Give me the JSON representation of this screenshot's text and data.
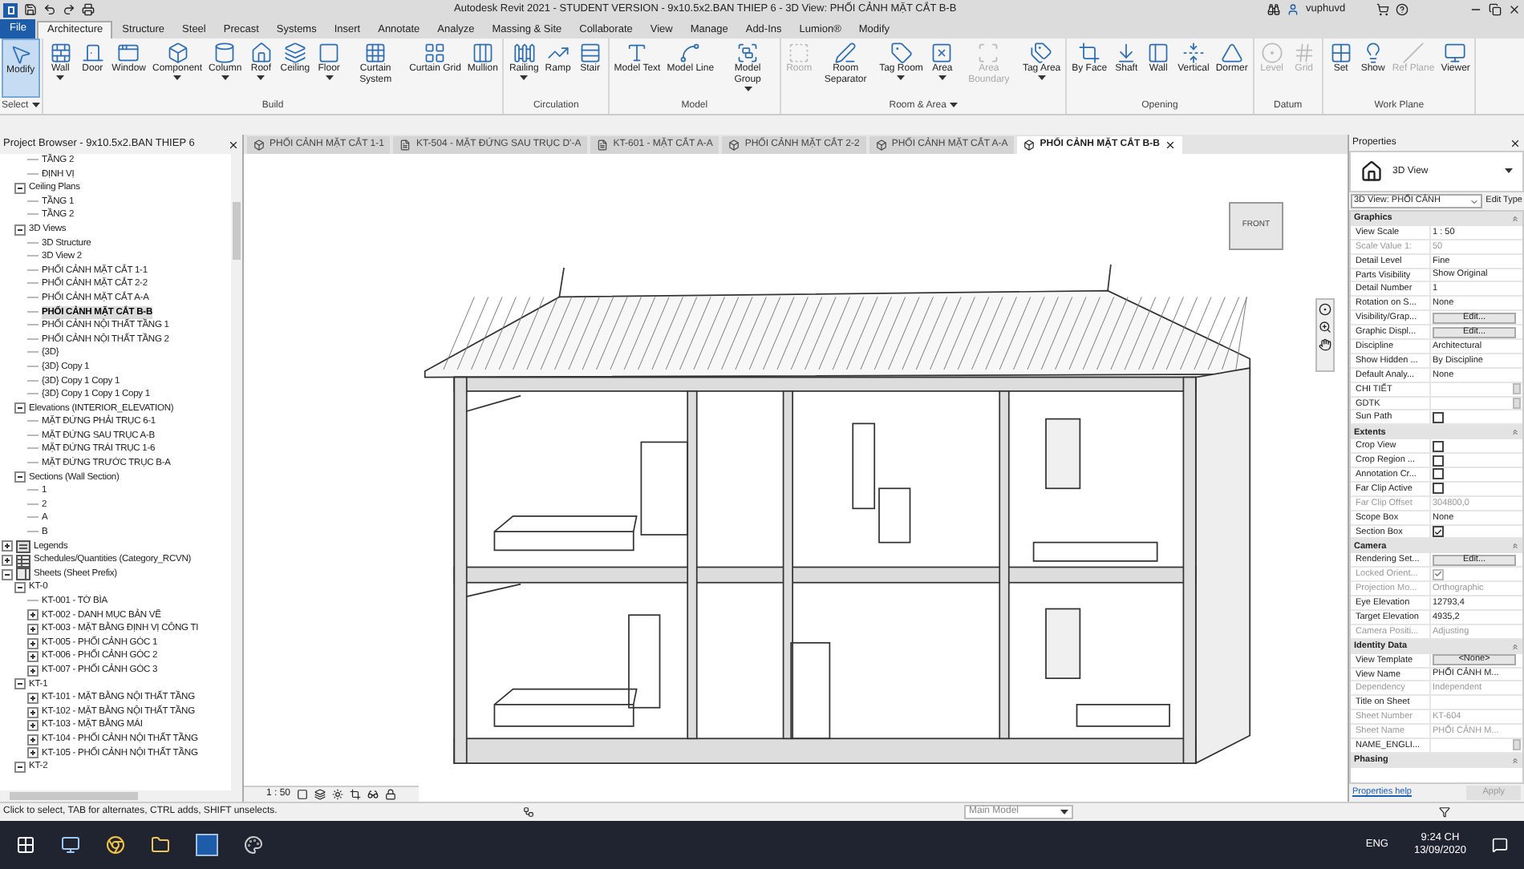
{
  "title_bar": {
    "title": "Autodesk Revit 2021 - STUDENT VERSION - 9x10.5x2.BAN THIEP 6 - 3D View: PHỐI CẢNH MẶT CẮT B-B",
    "user": "vuphuvd"
  },
  "ribbon_tabs": [
    {
      "label": "File",
      "selected": false,
      "kind": "file"
    },
    {
      "label": "Architecture",
      "selected": true,
      "kind": "tab"
    },
    {
      "label": "Structure",
      "selected": false,
      "kind": "tab"
    },
    {
      "label": "Steel",
      "selected": false,
      "kind": "tab"
    },
    {
      "label": "Precast",
      "selected": false,
      "kind": "tab"
    },
    {
      "label": "Systems",
      "selected": false,
      "kind": "tab"
    },
    {
      "label": "Insert",
      "selected": false,
      "kind": "tab"
    },
    {
      "label": "Annotate",
      "selected": false,
      "kind": "tab"
    },
    {
      "label": "Analyze",
      "selected": false,
      "kind": "tab"
    },
    {
      "label": "Massing & Site",
      "selected": false,
      "kind": "tab"
    },
    {
      "label": "Collaborate",
      "selected": false,
      "kind": "tab"
    },
    {
      "label": "View",
      "selected": false,
      "kind": "tab"
    },
    {
      "label": "Manage",
      "selected": false,
      "kind": "tab"
    },
    {
      "label": "Add-Ins",
      "selected": false,
      "kind": "tab"
    },
    {
      "label": "Lumion®",
      "selected": false,
      "kind": "tab"
    },
    {
      "label": "Modify",
      "selected": false,
      "kind": "tab"
    }
  ],
  "ribbon_groups": [
    {
      "label": "Select",
      "dropdown": true,
      "buttons": [
        {
          "label": "Modify",
          "selected": true,
          "dropdown": false,
          "disabled": false
        }
      ]
    },
    {
      "label": "Build",
      "dropdown": false,
      "buttons": [
        {
          "label": "Wall",
          "selected": false,
          "dropdown": true,
          "disabled": false
        },
        {
          "label": "Door",
          "selected": false,
          "dropdown": false,
          "disabled": false
        },
        {
          "label": "Window",
          "selected": false,
          "dropdown": false,
          "disabled": false
        },
        {
          "label": "Component",
          "selected": false,
          "dropdown": true,
          "disabled": false
        },
        {
          "label": "Column",
          "selected": false,
          "dropdown": true,
          "disabled": false
        },
        {
          "label": "Roof",
          "selected": false,
          "dropdown": true,
          "disabled": false
        },
        {
          "label": "Ceiling",
          "selected": false,
          "dropdown": false,
          "disabled": false
        },
        {
          "label": "Floor",
          "selected": false,
          "dropdown": true,
          "disabled": false
        },
        {
          "label": "Curtain System",
          "selected": false,
          "dropdown": false,
          "disabled": false
        },
        {
          "label": "Curtain Grid",
          "selected": false,
          "dropdown": false,
          "disabled": false
        },
        {
          "label": "Mullion",
          "selected": false,
          "dropdown": false,
          "disabled": false
        }
      ]
    },
    {
      "label": "Circulation",
      "dropdown": false,
      "buttons": [
        {
          "label": "Railing",
          "selected": false,
          "dropdown": true,
          "disabled": false
        },
        {
          "label": "Ramp",
          "selected": false,
          "dropdown": false,
          "disabled": false
        },
        {
          "label": "Stair",
          "selected": false,
          "dropdown": false,
          "disabled": false
        }
      ]
    },
    {
      "label": "Model",
      "dropdown": false,
      "buttons": [
        {
          "label": "Model Text",
          "selected": false,
          "dropdown": false,
          "disabled": false
        },
        {
          "label": "Model Line",
          "selected": false,
          "dropdown": false,
          "disabled": false
        },
        {
          "label": "Model Group",
          "selected": false,
          "dropdown": true,
          "disabled": false
        }
      ]
    },
    {
      "label": "Room & Area",
      "dropdown": true,
      "buttons": [
        {
          "label": "Room",
          "selected": false,
          "dropdown": false,
          "disabled": true
        },
        {
          "label": "Room Separator",
          "selected": false,
          "dropdown": false,
          "disabled": false
        },
        {
          "label": "Tag Room",
          "selected": false,
          "dropdown": true,
          "disabled": false
        },
        {
          "label": "Area",
          "selected": false,
          "dropdown": true,
          "disabled": false
        },
        {
          "label": "Area Boundary",
          "selected": false,
          "dropdown": false,
          "disabled": true
        },
        {
          "label": "Tag Area",
          "selected": false,
          "dropdown": true,
          "disabled": false
        }
      ]
    },
    {
      "label": "Opening",
      "dropdown": false,
      "buttons": [
        {
          "label": "By Face",
          "selected": false,
          "dropdown": false,
          "disabled": false
        },
        {
          "label": "Shaft",
          "selected": false,
          "dropdown": false,
          "disabled": false
        },
        {
          "label": "Wall",
          "selected": false,
          "dropdown": false,
          "disabled": false
        },
        {
          "label": "Vertical",
          "selected": false,
          "dropdown": false,
          "disabled": false
        },
        {
          "label": "Dormer",
          "selected": false,
          "dropdown": false,
          "disabled": false
        }
      ]
    },
    {
      "label": "Datum",
      "dropdown": false,
      "buttons": [
        {
          "label": "Level",
          "selected": false,
          "dropdown": false,
          "disabled": true
        },
        {
          "label": "Grid",
          "selected": false,
          "dropdown": false,
          "disabled": true
        }
      ]
    },
    {
      "label": "Work Plane",
      "dropdown": false,
      "buttons": [
        {
          "label": "Set",
          "selected": false,
          "dropdown": false,
          "disabled": false
        },
        {
          "label": "Show",
          "selected": false,
          "dropdown": false,
          "disabled": false
        },
        {
          "label": "Ref Plane",
          "selected": false,
          "dropdown": false,
          "disabled": true
        },
        {
          "label": "Viewer",
          "selected": false,
          "dropdown": false,
          "disabled": false
        }
      ]
    }
  ],
  "project_browser": {
    "title": "Project Browser - 9x10.5x2.BAN THIEP 6",
    "tree": [
      {
        "children": [
          {
            "children": [
              {
                "label": "TẦNG 2",
                "selected": false
              },
              {
                "label": "ĐỊNH VỊ",
                "selected": false
              }
            ]
          },
          {
            "label": "Ceiling Plans",
            "expanded": true,
            "selected": false,
            "children": [
              {
                "label": "TẦNG 1",
                "selected": false
              },
              {
                "label": "TẦNG 2",
                "selected": false
              }
            ]
          },
          {
            "label": "3D Views",
            "expanded": true,
            "selected": false,
            "children": [
              {
                "label": "3D Structure",
                "selected": false
              },
              {
                "label": "3D View 2",
                "selected": false
              },
              {
                "label": "PHỐI CẢNH MẶT CẮT 1-1",
                "selected": false
              },
              {
                "label": "PHỐI CẢNH MẶT CẮT 2-2",
                "selected": false
              },
              {
                "label": "PHỐI CẢNH MẶT CẮT A-A",
                "selected": false
              },
              {
                "label": "PHỐI CẢNH MẶT CẮT B-B",
                "selected": true
              },
              {
                "label": "PHỐI CẢNH NỘI THẤT TẦNG 1",
                "selected": false
              },
              {
                "label": "PHỐI CẢNH NỘI THẤT TẦNG  2",
                "selected": false
              },
              {
                "label": "{3D}",
                "selected": false
              },
              {
                "label": "{3D} Copy 1",
                "selected": false
              },
              {
                "label": "{3D} Copy 1 Copy 1",
                "selected": false
              },
              {
                "label": "{3D} Copy 1 Copy 1 Copy 1",
                "selected": false
              }
            ]
          },
          {
            "label": "Elevations (INTERIOR_ELEVATION)",
            "expanded": true,
            "selected": false,
            "children": [
              {
                "label": "MẶT ĐỨNG PHẢI TRỤC 6-1",
                "selected": false
              },
              {
                "label": "MẶT ĐỨNG SAU TRỤC A-B",
                "selected": false
              },
              {
                "label": "MẶT ĐỨNG TRÁI TRỤC 1-6",
                "selected": false
              },
              {
                "label": "MẶT ĐỨNG TRƯỚC TRỤC B-A",
                "selected": false
              }
            ]
          },
          {
            "label": "Sections (Wall Section)",
            "expanded": true,
            "selected": false,
            "children": [
              {
                "label": "1",
                "selected": false
              },
              {
                "label": "2",
                "selected": false
              },
              {
                "label": "A",
                "selected": false
              },
              {
                "label": "B",
                "selected": false
              }
            ]
          }
        ]
      },
      {
        "label": "Legends",
        "expanded": false,
        "selected": false,
        "kind": "legend"
      },
      {
        "label": "Schedules/Quantities (Category_RCVN)",
        "expanded": false,
        "selected": false,
        "kind": "schedule"
      },
      {
        "label": "Sheets (Sheet Prefix)",
        "expanded": true,
        "selected": false,
        "kind": "sheet",
        "children": [
          {
            "label": "KT-0",
            "expanded": true,
            "selected": false,
            "children": [
              {
                "label": "KT-001 - TỜ BÌA",
                "selected": false
              },
              {
                "label": "KT-002 - DANH MỤC BẢN VẼ",
                "expanded": false,
                "selected": false
              },
              {
                "label": "KT-003 - MẶT BẰNG ĐỊNH VỊ CÔNG TI",
                "expanded": false,
                "selected": false
              },
              {
                "label": "KT-005 - PHỐI CẢNH GÓC 1",
                "expanded": false,
                "selected": false
              },
              {
                "label": "KT-006 - PHỐI CẢNH GÓC 2",
                "expanded": false,
                "selected": false
              },
              {
                "label": "KT-007 - PHỐI CẢNH GÓC 3",
                "expanded": false,
                "selected": false
              }
            ]
          },
          {
            "label": "KT-1",
            "expanded": true,
            "selected": false,
            "children": [
              {
                "label": "KT-101 - MẶT BẰNG NỘI THẤT TẦNG",
                "expanded": false,
                "selected": false
              },
              {
                "label": "KT-102 - MẶT BẰNG NỘI THẤT TẦNG",
                "expanded": false,
                "selected": false
              },
              {
                "label": "KT-103 - MẶT BẰNG MÁI",
                "expanded": false,
                "selected": false
              },
              {
                "label": "KT-104 - PHỐI CẢNH NỘI THẤT TẦNG",
                "expanded": false,
                "selected": false
              },
              {
                "label": "KT-105 - PHỐI CẢNH NỘI THẤT TẦNG",
                "expanded": false,
                "selected": false
              }
            ]
          },
          {
            "label": "KT-2",
            "expanded": true,
            "selected": false
          }
        ]
      }
    ]
  },
  "view_tabs": [
    {
      "label": "PHỐI CẢNH MẶT CẮT 1-1",
      "selected": false,
      "kind": "model"
    },
    {
      "label": "KT-504 - MẶT ĐỨNG SAU TRỤC D'-A",
      "selected": false,
      "kind": "sheet"
    },
    {
      "label": "KT-601 - MẶT CẮT A-A",
      "selected": false,
      "kind": "sheet"
    },
    {
      "label": "PHỐI CẢNH MẶT CẮT 2-2",
      "selected": false,
      "kind": "model"
    },
    {
      "label": "PHỐI CẢNH MẶT CẮT A-A",
      "selected": false,
      "kind": "model"
    },
    {
      "label": "PHỐI CẢNH MẶT CẮT B-B",
      "selected": true,
      "kind": "model"
    }
  ],
  "view_cube": {
    "face": "FRONT"
  },
  "view_control_bar": {
    "scale": "1 : 50"
  },
  "properties": {
    "title": "Properties",
    "type": "3D View",
    "instance": "3D View: PHỐI CẢNH",
    "edit_type": "Edit Type",
    "rows": [
      {
        "kind": "header",
        "label": "Graphics"
      },
      {
        "kind": "text",
        "label": "View Scale",
        "value": "1 : 50",
        "disabled": false
      },
      {
        "kind": "text",
        "label": "Scale Value    1:",
        "value": "50",
        "disabled": true
      },
      {
        "kind": "text",
        "label": "Detail Level",
        "value": "Fine",
        "disabled": false
      },
      {
        "kind": "text",
        "label": "Parts Visibility",
        "value": "Show Original",
        "disabled": false
      },
      {
        "kind": "text",
        "label": "Detail Number",
        "value": "1",
        "disabled": false
      },
      {
        "kind": "text",
        "label": "Rotation on S...",
        "value": "None",
        "disabled": false
      },
      {
        "kind": "button",
        "label": "Visibility/Grap...",
        "value": "Edit...",
        "disabled": false
      },
      {
        "kind": "button",
        "label": "Graphic Displ...",
        "value": "Edit...",
        "disabled": false
      },
      {
        "kind": "text",
        "label": "Discipline",
        "value": "Architectural",
        "disabled": false
      },
      {
        "kind": "text",
        "label": "Show Hidden ...",
        "value": "By Discipline",
        "disabled": false
      },
      {
        "kind": "text",
        "label": "Default Analy...",
        "value": "None",
        "disabled": false
      },
      {
        "kind": "slot",
        "label": "CHI TIẾT",
        "disabled": false
      },
      {
        "kind": "slot",
        "label": "GDTK",
        "disabled": false
      },
      {
        "kind": "checkbox",
        "label": "Sun Path",
        "checked": false,
        "disabled": false
      },
      {
        "kind": "header",
        "label": "Extents"
      },
      {
        "kind": "checkbox",
        "label": "Crop View",
        "checked": false,
        "disabled": false
      },
      {
        "kind": "checkbox",
        "label": "Crop Region ...",
        "checked": false,
        "disabled": false
      },
      {
        "kind": "checkbox",
        "label": "Annotation Cr...",
        "checked": false,
        "disabled": false
      },
      {
        "kind": "checkbox",
        "label": "Far Clip Active",
        "checked": false,
        "disabled": false
      },
      {
        "kind": "text",
        "label": "Far Clip Offset",
        "value": "304800,0",
        "disabled": true
      },
      {
        "kind": "text",
        "label": "Scope Box",
        "value": "None",
        "disabled": false
      },
      {
        "kind": "checkbox",
        "label": "Section Box",
        "checked": true,
        "disabled": false
      },
      {
        "kind": "header",
        "label": "Camera"
      },
      {
        "kind": "button",
        "label": "Rendering Set...",
        "value": "Edit...",
        "disabled": false
      },
      {
        "kind": "checkbox",
        "label": "Locked Orient...",
        "checked": true,
        "disabled": true
      },
      {
        "kind": "text",
        "label": "Projection Mo...",
        "value": "Orthographic",
        "disabled": true
      },
      {
        "kind": "text",
        "label": "Eye Elevation",
        "value": "12793,4",
        "disabled": false
      },
      {
        "kind": "text",
        "label": "Target Elevation",
        "value": "4935,2",
        "disabled": false
      },
      {
        "kind": "text",
        "label": "Camera Positi...",
        "value": "Adjusting",
        "disabled": true
      },
      {
        "kind": "header",
        "label": "Identity Data"
      },
      {
        "kind": "button",
        "label": "View Template",
        "value": "<None>",
        "disabled": false
      },
      {
        "kind": "text",
        "label": "View Name",
        "value": "PHỐI CẢNH M...",
        "disabled": false
      },
      {
        "kind": "text",
        "label": "Dependency",
        "value": "Independent",
        "disabled": true
      },
      {
        "kind": "text",
        "label": "Title on Sheet",
        "disabled": false
      },
      {
        "kind": "text",
        "label": "Sheet Number",
        "value": "KT-604",
        "disabled": true
      },
      {
        "kind": "text",
        "label": "Sheet Name",
        "value": "PHỐI CẢNH M...",
        "disabled": true
      },
      {
        "kind": "slot",
        "label": "NAME_ENGLI...",
        "disabled": false
      },
      {
        "kind": "header",
        "label": "Phasing"
      }
    ],
    "help": "Properties help",
    "apply": {
      "label": "Apply",
      "disabled": true
    }
  },
  "status_bar": {
    "message": "Click to select, TAB for alternates, CTRL adds, SHIFT unselects.",
    "model": "Main Model"
  },
  "taskbar": {
    "language": "ENG",
    "time": "9:24 CH",
    "date": "13/09/2020"
  }
}
